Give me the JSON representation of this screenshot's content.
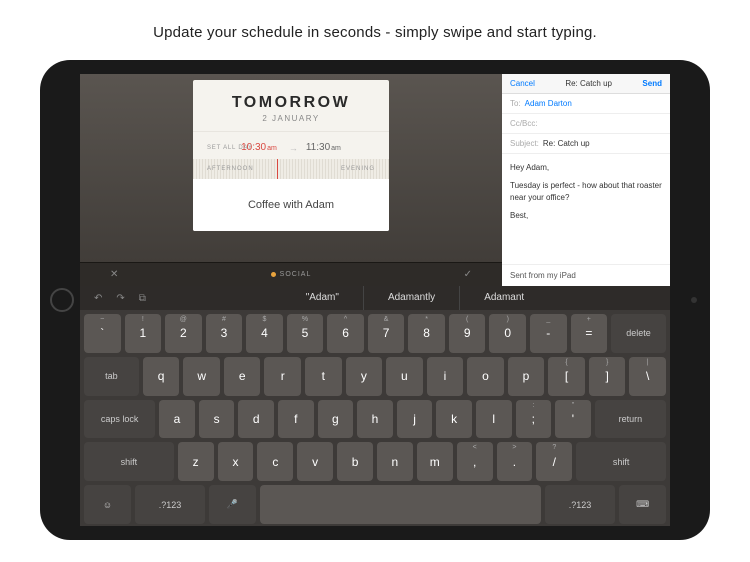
{
  "tagline": "Update your schedule in seconds - simply swipe and start typing.",
  "event": {
    "day_label": "TOMORROW",
    "date_label": "2 JANUARY",
    "all_day_label": "SET ALL DAY",
    "start_time": "10:30",
    "start_ampm": "am",
    "arrow": "→",
    "end_time": "11:30",
    "end_ampm": "am",
    "ruler_left": "AFTERNOON",
    "ruler_right": "EVENING",
    "title": "Coffee with Adam"
  },
  "calendar_toolbar": {
    "close": "✕",
    "category": "SOCIAL",
    "confirm": "✓"
  },
  "mail": {
    "cancel": "Cancel",
    "title": "Re: Catch up",
    "send": "Send",
    "to_label": "To:",
    "to_value": "Adam Darton",
    "ccbcc_label": "Cc/Bcc:",
    "subject_label": "Subject:",
    "subject_value": "Re: Catch up",
    "body_greeting": "Hey Adam,",
    "body_line": "Tuesday is perfect - how about that roaster near your office?",
    "body_signoff": "Best,",
    "signature": "Sent from my iPad"
  },
  "suggestions": {
    "icons": {
      "undo": "↶",
      "redo": "↷",
      "paste": "⧉"
    },
    "items": [
      "\"Adam\"",
      "Adamantly",
      "Adamant"
    ]
  },
  "keyboard": {
    "row1_alts": [
      "~",
      "!",
      "@",
      "#",
      "$",
      "%",
      "^",
      "&",
      "*",
      "(",
      ")",
      "_",
      "+"
    ],
    "row1": [
      "`",
      "1",
      "2",
      "3",
      "4",
      "5",
      "6",
      "7",
      "8",
      "9",
      "0",
      "-",
      "="
    ],
    "row1_delete": "delete",
    "row2_tab": "tab",
    "row2": [
      "q",
      "w",
      "e",
      "r",
      "t",
      "y",
      "u",
      "i",
      "o",
      "p"
    ],
    "row2_brackets": [
      "[",
      "]",
      "\\"
    ],
    "row2_brackets_alt": [
      "{",
      "}",
      "|"
    ],
    "row3_caps": "caps lock",
    "row3": [
      "a",
      "s",
      "d",
      "f",
      "g",
      "h",
      "j",
      "k",
      "l"
    ],
    "row3_end": [
      ";",
      "'"
    ],
    "row3_end_alt": [
      ":",
      "\""
    ],
    "row3_return": "return",
    "row4_shift": "shift",
    "row4": [
      "z",
      "x",
      "c",
      "v",
      "b",
      "n",
      "m"
    ],
    "row4_end": [
      ",",
      ".",
      "/"
    ],
    "row4_end_alt": [
      "<",
      ">",
      "?"
    ],
    "row5": {
      "globe": "☺",
      "numkey": ".?123",
      "mic": "🎤",
      "hide": "⌨"
    }
  }
}
